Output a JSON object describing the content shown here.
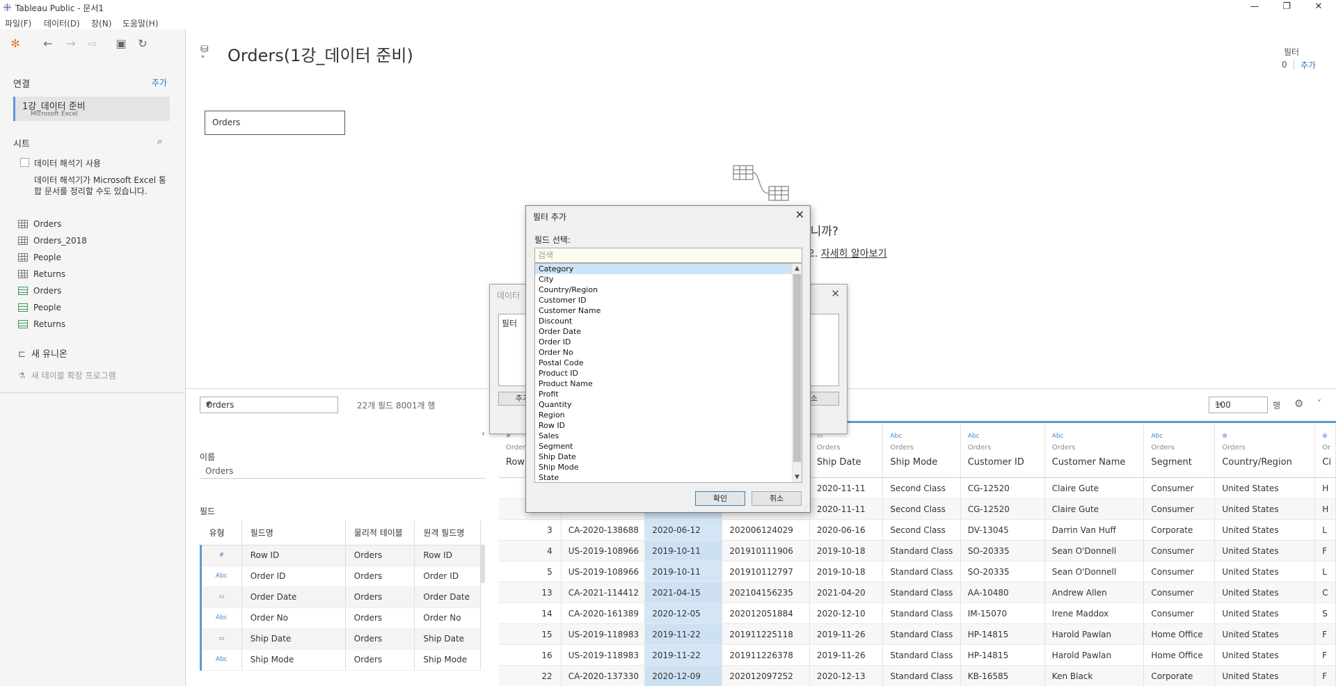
{
  "window": {
    "title": "Tableau Public - 문서1",
    "minimize": "—",
    "maximize": "❐",
    "close": "✕"
  },
  "menu": [
    "파일(F)",
    "데이터(D)",
    "창(N)",
    "도움말(H)"
  ],
  "left": {
    "connections_title": "연결",
    "connections_add": "추가",
    "connection_name": "1강_데이터 준비",
    "connection_type": "Microsoft Excel",
    "sheets_title": "시트",
    "interpreter_label": "데이터 해석기 사용",
    "interpreter_desc": "데이터 해석기가 Microsoft Excel 통합 문서를 정리할 수도 있습니다.",
    "sheets": [
      {
        "name": "Orders",
        "icon": "table-icon"
      },
      {
        "name": "Orders_2018",
        "icon": "table-icon"
      },
      {
        "name": "People",
        "icon": "table-icon"
      },
      {
        "name": "Returns",
        "icon": "table-icon"
      },
      {
        "name": "Orders",
        "icon": "named-range-icon"
      },
      {
        "name": "People",
        "icon": "named-range-icon"
      },
      {
        "name": "Returns",
        "icon": "named-range-icon"
      }
    ],
    "new_union": "새 유니온",
    "new_extension": "새 테이블 확장 프로그램"
  },
  "canvas": {
    "title": "Orders(1강_데이터 준비)",
    "filter_label": "필터",
    "filter_count": "0",
    "filter_add": "추가",
    "table_chip": "Orders",
    "hint_text": "십니까?",
    "hint_prefix": "오.",
    "hint_link": "자세히 알아보기"
  },
  "grid_toolbar": {
    "table_select": "Orders",
    "field_count": "22개 필드 8001개 행",
    "rows_value": "100",
    "rows_unit": "행"
  },
  "metadata": {
    "name_label": "이름",
    "name_value": "Orders",
    "fields_label": "필드",
    "headers": [
      "유형",
      "필드명",
      "물리적 테이블",
      "원격 필드명"
    ],
    "rows": [
      {
        "type": "#",
        "name": "Row ID",
        "table": "Orders",
        "remote": "Row ID"
      },
      {
        "type": "Abc",
        "name": "Order ID",
        "table": "Orders",
        "remote": "Order ID"
      },
      {
        "type": "▭",
        "name": "Order Date",
        "table": "Orders",
        "remote": "Order Date"
      },
      {
        "type": "Abc",
        "name": "Order No",
        "table": "Orders",
        "remote": "Order No"
      },
      {
        "type": "▭",
        "name": "Ship Date",
        "table": "Orders",
        "remote": "Ship Date"
      },
      {
        "type": "Abc",
        "name": "Ship Mode",
        "table": "Orders",
        "remote": "Ship Mode"
      }
    ]
  },
  "data_grid": {
    "headers": [
      {
        "icon": "#",
        "src": "Orders",
        "name": "Row"
      },
      {
        "icon": "",
        "src": "",
        "name": ""
      },
      {
        "icon": "",
        "src": "",
        "name": ""
      },
      {
        "icon": "",
        "src": "",
        "name": ""
      },
      {
        "icon": "▭",
        "src": "Orders",
        "name": "Ship Date"
      },
      {
        "icon": "Abc",
        "src": "Orders",
        "name": "Ship Mode"
      },
      {
        "icon": "Abc",
        "src": "Orders",
        "name": "Customer ID"
      },
      {
        "icon": "Abc",
        "src": "Orders",
        "name": "Customer Name"
      },
      {
        "icon": "Abc",
        "src": "Orders",
        "name": "Segment"
      },
      {
        "icon": "⊕",
        "src": "Orders",
        "name": "Country/Region"
      },
      {
        "icon": "⊕",
        "src": "Or",
        "name": "Ci"
      }
    ],
    "rows": [
      [
        "",
        "",
        "",
        "",
        "2020-11-11",
        "Second Class",
        "CG-12520",
        "Claire Gute",
        "Consumer",
        "United States",
        "H"
      ],
      [
        "",
        "",
        "",
        "",
        "2020-11-11",
        "Second Class",
        "CG-12520",
        "Claire Gute",
        "Consumer",
        "United States",
        "H"
      ],
      [
        "3",
        "CA-2020-138688",
        "2020-06-12",
        "202006124029",
        "2020-06-16",
        "Second Class",
        "DV-13045",
        "Darrin Van Huff",
        "Corporate",
        "United States",
        "L"
      ],
      [
        "4",
        "US-2019-108966",
        "2019-10-11",
        "201910111906",
        "2019-10-18",
        "Standard Class",
        "SO-20335",
        "Sean O'Donnell",
        "Consumer",
        "United States",
        "F"
      ],
      [
        "5",
        "US-2019-108966",
        "2019-10-11",
        "201910112797",
        "2019-10-18",
        "Standard Class",
        "SO-20335",
        "Sean O'Donnell",
        "Consumer",
        "United States",
        "L"
      ],
      [
        "13",
        "CA-2021-114412",
        "2021-04-15",
        "202104156235",
        "2021-04-20",
        "Standard Class",
        "AA-10480",
        "Andrew Allen",
        "Consumer",
        "United States",
        "C"
      ],
      [
        "14",
        "CA-2020-161389",
        "2020-12-05",
        "202012051884",
        "2020-12-10",
        "Standard Class",
        "IM-15070",
        "Irene Maddox",
        "Consumer",
        "United States",
        "S"
      ],
      [
        "15",
        "US-2019-118983",
        "2019-11-22",
        "201911225118",
        "2019-11-26",
        "Standard Class",
        "HP-14815",
        "Harold Pawlan",
        "Home Office",
        "United States",
        "F"
      ],
      [
        "16",
        "US-2019-118983",
        "2019-11-22",
        "201911226378",
        "2019-11-26",
        "Standard Class",
        "HP-14815",
        "Harold Pawlan",
        "Home Office",
        "United States",
        "F"
      ],
      [
        "22",
        "CA-2020-137330",
        "2020-12-09",
        "202012097252",
        "2020-12-13",
        "Standard Class",
        "KB-16585",
        "Ken Black",
        "Corporate",
        "United States",
        "F"
      ]
    ]
  },
  "bg_dialog": {
    "title": "데이터 ",
    "list_label": "필터",
    "add_button": "추가",
    "cancel_button": "소"
  },
  "dialog": {
    "title": "필터 추가",
    "field_label": "필드 선택:",
    "search_placeholder": "검색",
    "fields": [
      "Category",
      "City",
      "Country/Region",
      "Customer ID",
      "Customer Name",
      "Discount",
      "Order Date",
      "Order ID",
      "Order No",
      "Postal Code",
      "Product ID",
      "Product Name",
      "Profit",
      "Quantity",
      "Region",
      "Row ID",
      "Sales",
      "Segment",
      "Ship Date",
      "Ship Mode",
      "State"
    ],
    "selected_index": 0,
    "ok_button": "확인",
    "cancel_button": "취소"
  }
}
